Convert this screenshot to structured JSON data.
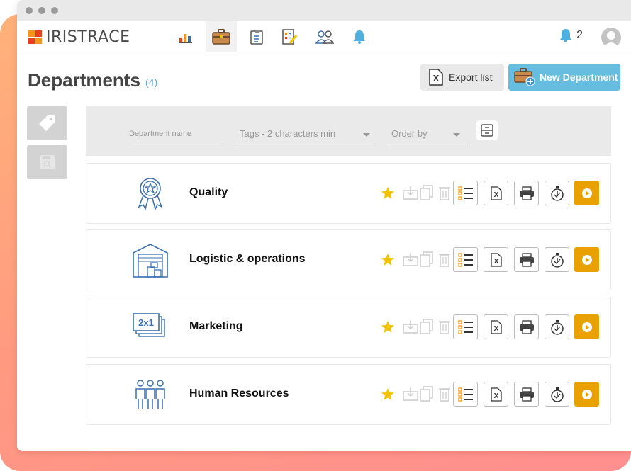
{
  "app": {
    "name": "IRISTRACE"
  },
  "notifications": {
    "count": "2"
  },
  "header": {
    "title": "Departments",
    "count": "(4)",
    "export_label": "Export list",
    "new_label": "New Department"
  },
  "filters": {
    "name_placeholder": "Department name",
    "tags_placeholder": "Tags - 2 characters min",
    "order_placeholder": "Order by"
  },
  "departments": [
    {
      "label": "Quality",
      "icon": "award-ribbon-icon"
    },
    {
      "label": "Logistic & operations",
      "icon": "warehouse-icon"
    },
    {
      "label": "Marketing",
      "icon": "2x1-promo-icon"
    },
    {
      "label": "Human Resources",
      "icon": "people-group-icon"
    }
  ],
  "colors": {
    "accent_blue": "#67bde0",
    "play_orange": "#e8a100",
    "icon_blue": "#3a6fb0",
    "star_yellow": "#f2c300"
  }
}
